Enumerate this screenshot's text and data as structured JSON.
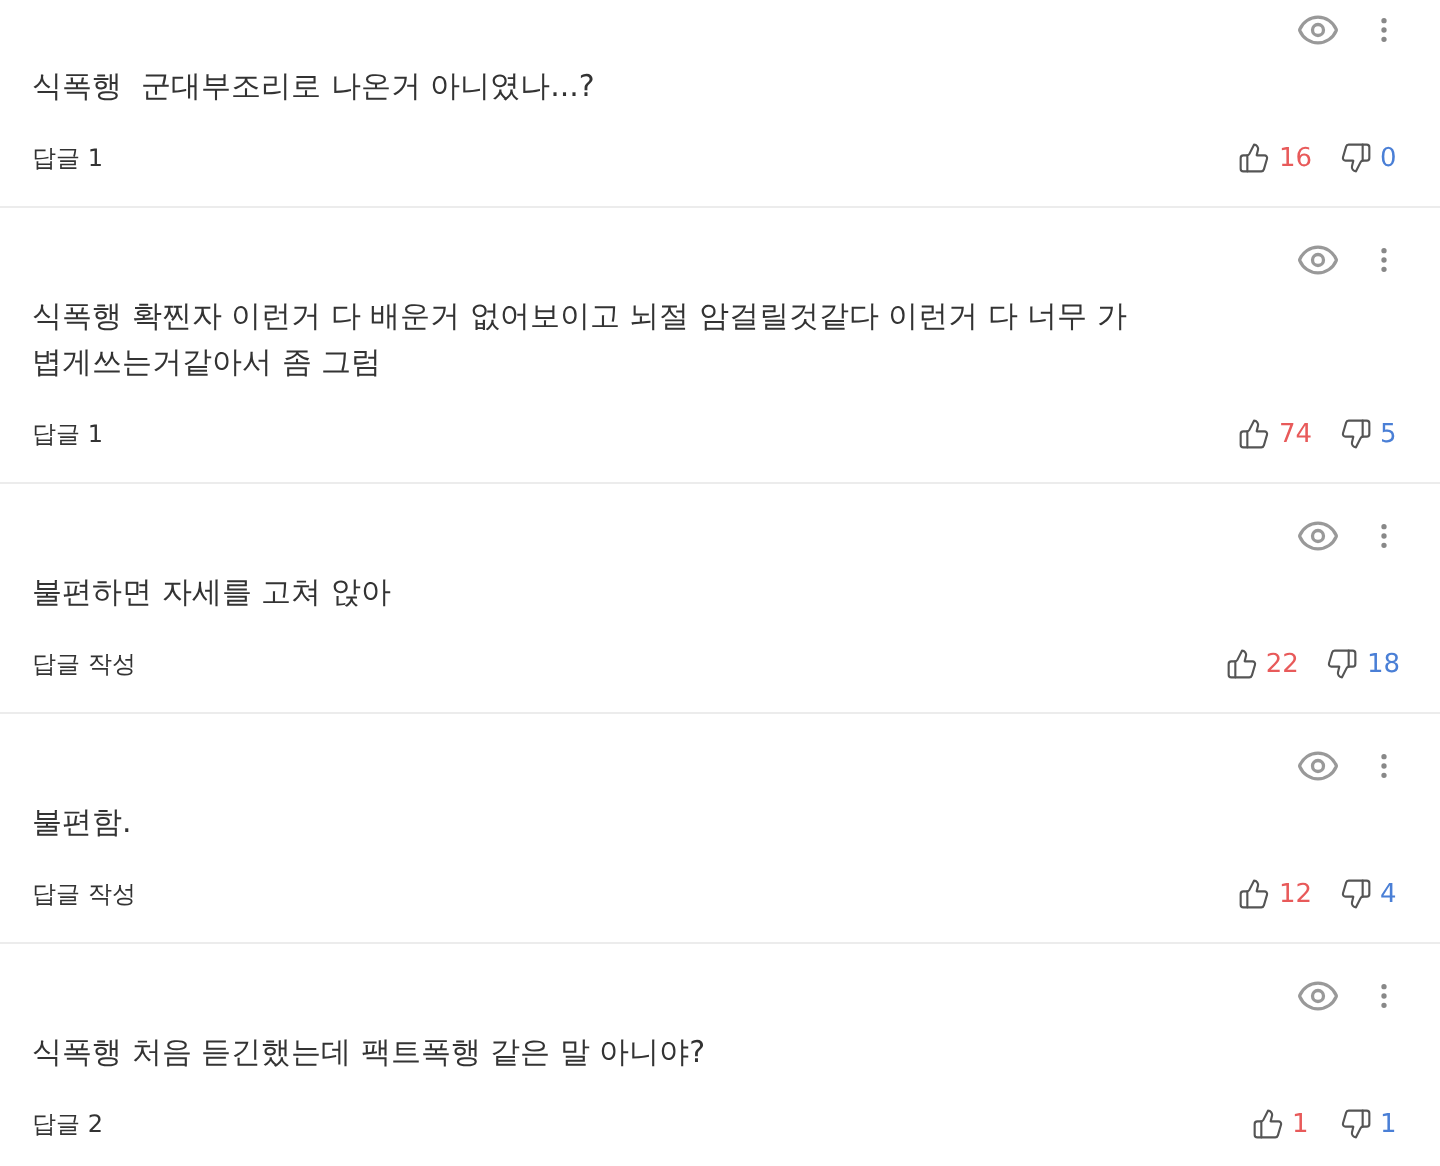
{
  "comments": [
    {
      "text": "식폭행  군대부조리로 나온거 아니였나...?",
      "reply": "답글 1",
      "likes": "16",
      "dislikes": "0"
    },
    {
      "text": "식폭행 확찐자 이런거 다 배운거 없어보이고 뇌절 암걸릴것같다 이런거 다 너무 가볍게쓰는거같아서 좀 그럼",
      "reply": "답글 1",
      "likes": "74",
      "dislikes": "5"
    },
    {
      "text": "불편하면 자세를 고쳐 앉아",
      "reply": "답글 작성",
      "likes": "22",
      "dislikes": "18"
    },
    {
      "text": "불편함.",
      "reply": "답글 작성",
      "likes": "12",
      "dislikes": "4"
    },
    {
      "text": "식폭행 처음 듣긴했는데 팩트폭행 같은 말 아니야?",
      "reply": "답글 2",
      "likes": "1",
      "dislikes": "1"
    }
  ]
}
